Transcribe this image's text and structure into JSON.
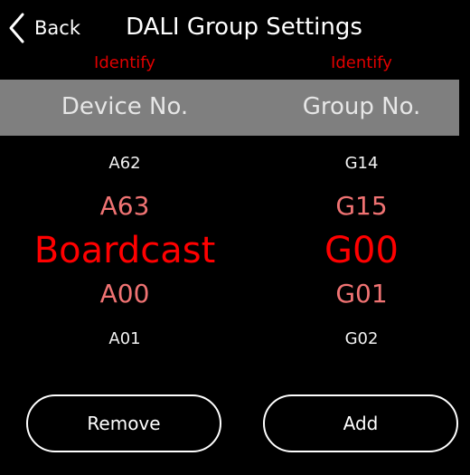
{
  "header": {
    "back_label": "Back",
    "title": "DALI Group Settings"
  },
  "device_column": {
    "identify_label": "Identify",
    "title": "Device No.",
    "picker": {
      "above_far": "A62",
      "above_near": "A63",
      "selected": "Boardcast",
      "below_near": "A00",
      "below_far": "A01"
    }
  },
  "group_column": {
    "identify_label": "Identify",
    "title": "Group No.",
    "picker": {
      "above_far": "G14",
      "above_near": "G15",
      "selected": "G00",
      "below_near": "G01",
      "below_far": "G02"
    }
  },
  "actions": {
    "remove_label": "Remove",
    "add_label": "Add"
  },
  "colors": {
    "background": "#000000",
    "accent_red": "#ff0000",
    "header_band": "#7f7f7f"
  },
  "icons": {
    "back": "chevron-left-icon"
  }
}
